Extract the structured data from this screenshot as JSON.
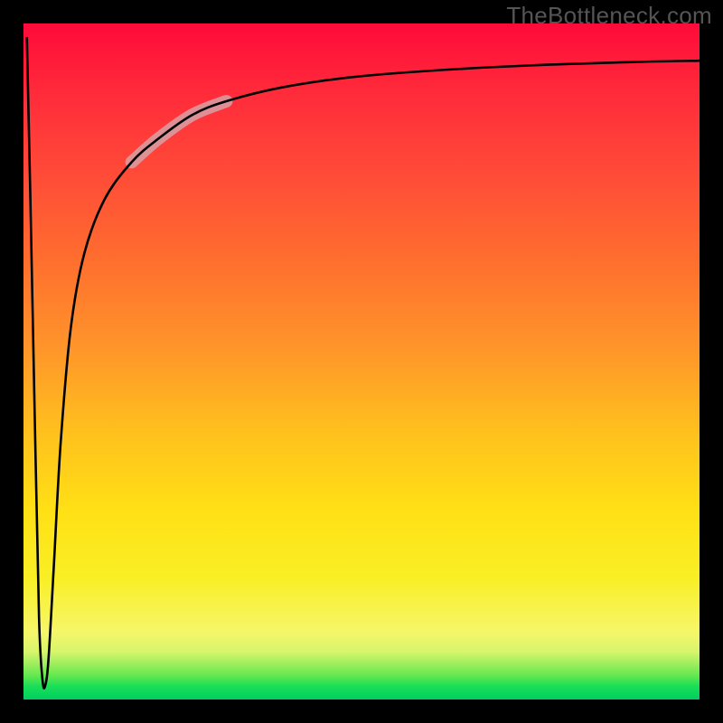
{
  "watermark": "TheBottleneck.com",
  "chart_data": {
    "type": "line",
    "title": "",
    "xlabel": "",
    "ylabel": "",
    "xlim": [
      0,
      100
    ],
    "ylim": [
      0,
      100
    ],
    "grid": false,
    "legend": false,
    "notes": "Unlabeled bottleneck-style curve over a vertical red→yellow→green gradient. No axis ticks or numeric labels are rendered; x/y values below are read off as percentages of the plot area (0 = left/bottom, 100 = right/top), estimated from the rendered curve shape.",
    "series": [
      {
        "name": "curve",
        "x": [
          0.5,
          1.0,
          1.7,
          2.3,
          2.8,
          3.2,
          3.7,
          4.5,
          5.5,
          7.0,
          9.0,
          12.0,
          16.0,
          20.0,
          25.0,
          30.0,
          38.0,
          48.0,
          60.0,
          75.0,
          90.0,
          100.0
        ],
        "y": [
          98.0,
          75.0,
          40.0,
          12.0,
          3.0,
          2.0,
          6.0,
          20.0,
          38.0,
          55.0,
          66.0,
          74.0,
          79.5,
          83.0,
          86.5,
          88.5,
          90.5,
          92.0,
          93.0,
          93.8,
          94.3,
          94.5
        ]
      }
    ],
    "highlight_segment": {
      "description": "Faded thick pinkish segment along the rising part of the curve",
      "x_range": [
        18.0,
        26.0
      ]
    },
    "gradient_stops": [
      {
        "pos": 0.0,
        "color": "#ff0a3a"
      },
      {
        "pos": 0.35,
        "color": "#ff6e2e"
      },
      {
        "pos": 0.6,
        "color": "#ffbf1e"
      },
      {
        "pos": 0.82,
        "color": "#f9ef25"
      },
      {
        "pos": 0.93,
        "color": "#d6f56c"
      },
      {
        "pos": 1.0,
        "color": "#00d060"
      }
    ]
  }
}
